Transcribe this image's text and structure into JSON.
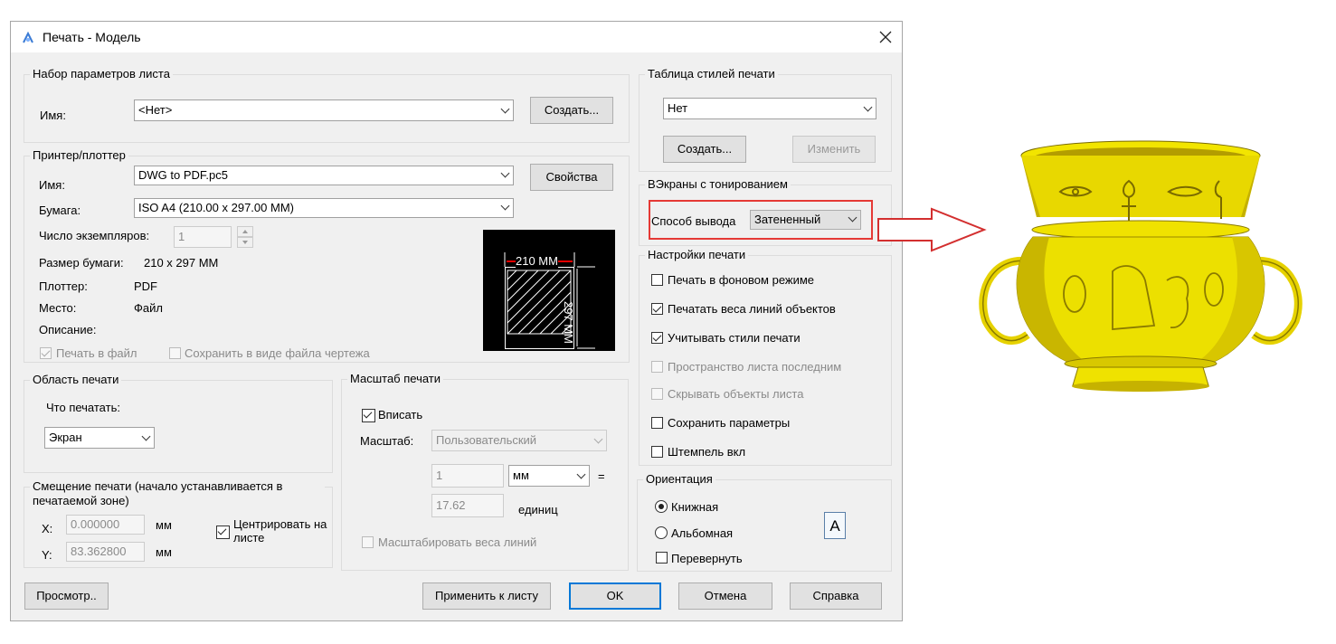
{
  "window": {
    "title": "Печать - Модель"
  },
  "page_setup": {
    "title": "Набор параметров листа",
    "name_label": "Имя:",
    "name_value": "<Нет>",
    "create_btn": "Создать..."
  },
  "printer": {
    "title": "Принтер/плоттер",
    "name_label": "Имя:",
    "name_value": "DWG to PDF.pc5",
    "props_btn": "Свойства",
    "paper_label": "Бумага:",
    "paper_value": "ISO A4 (210.00 x 297.00 MM)",
    "copies_label": "Число экземпляров:",
    "copies_value": "1",
    "size_label": "Размер бумаги:",
    "size_value": "210 x 297  MM",
    "plotter_label": "Плоттер:",
    "plotter_value": "PDF",
    "location_label": "Место:",
    "location_value": "Файл",
    "desc_label": "Описание:",
    "print_to_file": "Печать в файл",
    "save_as_file": "Сохранить в виде файла чертежа",
    "preview": {
      "width_text": "210 MM",
      "height_text": "297 MM"
    }
  },
  "plot_styles": {
    "title": "Таблица стилей печати",
    "value": "Нет",
    "create_btn": "Создать...",
    "edit_btn": "Изменить"
  },
  "shaded": {
    "title": "ВЭкраны с тонированием",
    "mode_label": "Способ вывода",
    "mode_value": "Затененный"
  },
  "options": {
    "title": "Настройки печати",
    "items": [
      {
        "label": "Печать в фоновом режиме",
        "checked": false,
        "enabled": true
      },
      {
        "label": "Печатать веса линий объектов",
        "checked": true,
        "enabled": true
      },
      {
        "label": "Учитывать стили печати",
        "checked": true,
        "enabled": true
      },
      {
        "label": "Пространство листа последним",
        "checked": false,
        "enabled": false
      },
      {
        "label": "Скрывать объекты листа",
        "checked": false,
        "enabled": false
      },
      {
        "label": "Сохранить параметры",
        "checked": false,
        "enabled": true
      },
      {
        "label": "Штемпель вкл",
        "checked": false,
        "enabled": true
      }
    ]
  },
  "area": {
    "title": "Область печати",
    "what_label": "Что печатать:",
    "what_value": "Экран"
  },
  "offset": {
    "title": "Смещение печати (начало устанавливается в печатаемой зоне)",
    "x_label": "X:",
    "x_value": "0.000000",
    "x_unit": "мм",
    "y_label": "Y:",
    "y_value": "83.362800",
    "y_unit": "мм",
    "center_label": "Центрировать на листе"
  },
  "scale": {
    "title": "Масштаб печати",
    "fit_label": "Вписать",
    "scale_label": "Масштаб:",
    "scale_value": "Пользовательский",
    "v1": "1",
    "unit_value": "мм",
    "eq": "=",
    "v2": "17.62",
    "units_label": "единиц",
    "lw_label": "Масштабировать веса линий"
  },
  "orientation": {
    "title": "Ориентация",
    "portrait": "Книжная",
    "landscape": "Альбомная",
    "flip": "Перевернуть",
    "icon_letter": "A"
  },
  "footer": {
    "preview_btn": "Просмотр..",
    "apply_btn": "Применить к листу",
    "ok_btn": "OK",
    "cancel_btn": "Отмена",
    "help_btn": "Справка"
  }
}
